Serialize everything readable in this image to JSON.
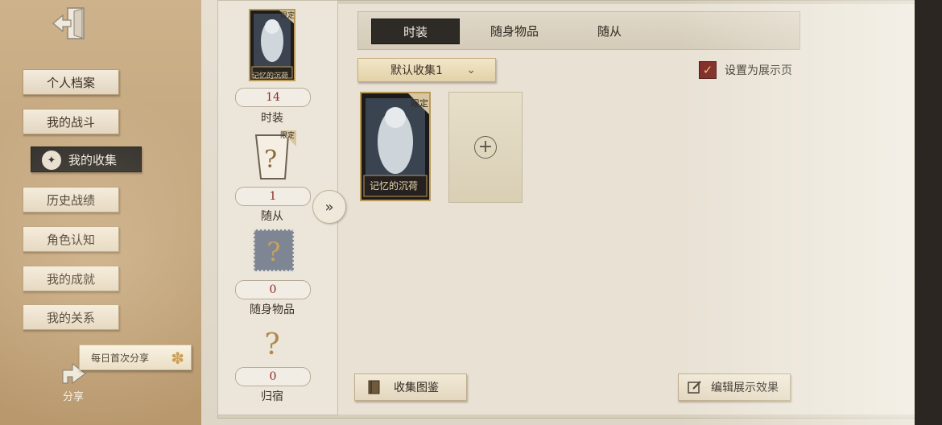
{
  "sidebar": {
    "items": [
      {
        "label": "个人档案",
        "active": false
      },
      {
        "label": "我的战斗",
        "active": false
      },
      {
        "label": "我的收集",
        "active": true
      },
      {
        "label": "历史战绩",
        "active": false
      },
      {
        "label": "角色认知",
        "active": false
      },
      {
        "label": "我的成就",
        "active": false
      },
      {
        "label": "我的关系",
        "active": false
      }
    ],
    "share_tip": "每日首次分享",
    "share_label": "分享"
  },
  "stats": [
    {
      "count": "14",
      "label": "时装",
      "tag": "限定",
      "card_title": "记忆的沉荷"
    },
    {
      "count": "1",
      "label": "随从",
      "tag": "限定"
    },
    {
      "count": "0",
      "label": "随身物品"
    },
    {
      "count": "0",
      "label": "归宿"
    }
  ],
  "tabs": [
    {
      "label": "时装",
      "active": true
    },
    {
      "label": "随身物品",
      "active": false
    },
    {
      "label": "随从",
      "active": false
    }
  ],
  "collection_dropdown": {
    "selected": "默认收集1"
  },
  "showcase_checkbox": {
    "label": "设置为展示页",
    "checked": true
  },
  "items": [
    {
      "tag": "限定",
      "title": "记忆的沉荷"
    }
  ],
  "buttons": {
    "collection_guide": "收集图鉴",
    "edit_display": "编辑展示效果"
  },
  "colors": {
    "accent_red": "#7d241f",
    "dark_tab": "#2e2a26",
    "parchment": "#e8e1d4"
  }
}
